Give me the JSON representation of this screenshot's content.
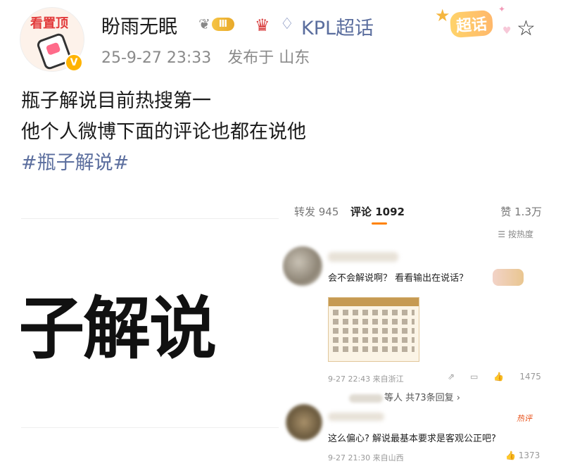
{
  "post": {
    "username": "盼雨无眠",
    "level_label": "Ⅲ",
    "topic": "KPL超话",
    "timestamp": "25-9-27 23:33",
    "location": "发布于 山东",
    "avatar_text": "看置顶",
    "badge": "超话",
    "text_lines": [
      "瓶子解说目前热搜第一",
      "他个人微博下面的评论也都在说他"
    ],
    "hashtag": "#瓶子解说#"
  },
  "left_image": {
    "text": "子解说"
  },
  "right_image": {
    "tabs": {
      "repost": "转发 945",
      "comments": "评论 1092",
      "likes": "赞 1.3万"
    },
    "sort": "☰ 按热度",
    "comment1": {
      "text": "会不会解说啊？ 看看输出在说话？",
      "meta": "9-27 22:43  来自浙江",
      "likes": "1475",
      "replies": "等人  共73条回复 ›"
    },
    "comment2": {
      "hot_tag": "热评",
      "text": "这么偏心? 解说最基本要求是客观公正吧?",
      "meta": "9-27 21:30  来自山西",
      "likes": "1373"
    }
  },
  "icons": {
    "fav": "star-outline-icon",
    "diamond": "diamond-icon",
    "vip": "v-badge-icon"
  },
  "colors": {
    "link": "#5b6e9e",
    "accent": "#ff8200"
  }
}
